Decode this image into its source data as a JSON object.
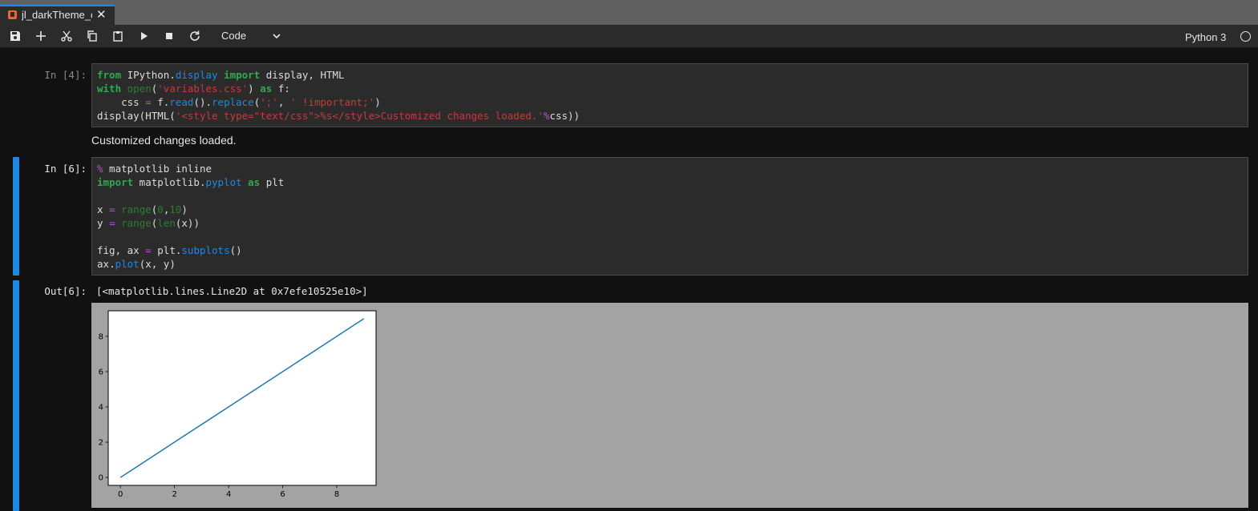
{
  "tab": {
    "title": "jl_darkTheme_c",
    "close": "✕"
  },
  "toolbar": {
    "cell_type": "Code",
    "kernel_name": "Python 3"
  },
  "cells": [
    {
      "prompt": "In [4]:",
      "output_html": "Customized changes loaded."
    },
    {
      "prompt": "In [6]:",
      "output_prompt": "Out[6]:",
      "output_text": "[<matplotlib.lines.Line2D at 0x7efe10525e10>]"
    }
  ],
  "colors": {
    "accent": "#1e88e5",
    "keyword": "#2faa50",
    "string": "#c63b3b",
    "operator": "#b451d6",
    "line": "#1f77b4"
  },
  "chart_data": {
    "type": "line",
    "x": [
      0,
      1,
      2,
      3,
      4,
      5,
      6,
      7,
      8,
      9
    ],
    "series": [
      {
        "values": [
          0,
          1,
          2,
          3,
          4,
          5,
          6,
          7,
          8,
          9
        ]
      }
    ],
    "title": "",
    "xlabel": "",
    "ylabel": "",
    "xticks": [
      "0",
      "2",
      "4",
      "6",
      "8"
    ],
    "yticks": [
      "0",
      "2",
      "4",
      "6",
      "8"
    ],
    "xlim": [
      -0.45,
      9.45
    ],
    "ylim": [
      -0.45,
      9.45
    ],
    "grid": false
  }
}
